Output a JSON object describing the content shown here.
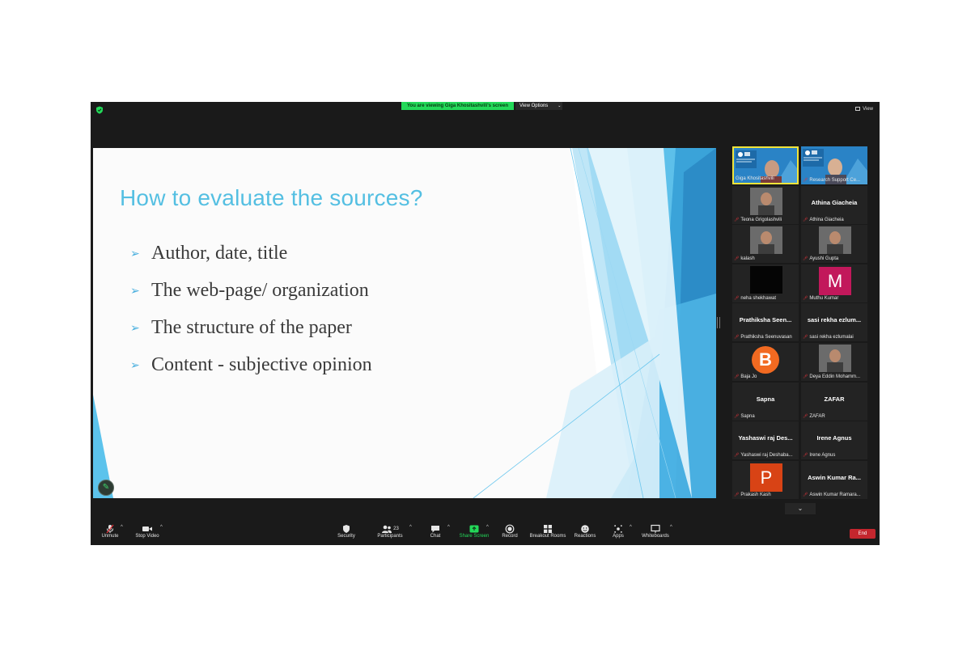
{
  "top_bar": {
    "viewing_banner": "You are viewing Giga Khositashvili's screen",
    "view_options_label": "View Options",
    "view_button_label": "View"
  },
  "slide": {
    "title": "How to evaluate the sources?",
    "bullets": [
      "Author, date, title",
      "The web-page/ organization",
      "The structure of the paper",
      "Content - subjective opinion"
    ],
    "bullet_marker": "➢",
    "accent_color": "#54bfe2"
  },
  "participants": [
    {
      "display": "",
      "label": "Giga Khositashvili",
      "type": "video-banner",
      "active": true
    },
    {
      "display": "",
      "label": "Research Support Ce...",
      "type": "video-banner"
    },
    {
      "display": "",
      "label": "Teona Grigolashvili",
      "type": "photo"
    },
    {
      "display": "Athina Giacheia",
      "label": "Athina Giacheia",
      "type": "name"
    },
    {
      "display": "",
      "label": "kalash",
      "type": "photo"
    },
    {
      "display": "",
      "label": "Ayushi Gupta",
      "type": "photo"
    },
    {
      "display": "",
      "label": "neha shekhawat",
      "type": "black"
    },
    {
      "display": "M",
      "label": "Muthu Kumar",
      "type": "letter",
      "color": "#c2185b"
    },
    {
      "display": "Prathiksha Seen...",
      "label": "Prathiksha Seenuvasan",
      "type": "name"
    },
    {
      "display": "sasi rekha ezlum...",
      "label": "sasi rekha ezlumalai",
      "type": "name"
    },
    {
      "display": "B",
      "label": "Baja Jo",
      "type": "letter-circle",
      "color": "#f26a21"
    },
    {
      "display": "",
      "label": "Deya Eddin Mohamm...",
      "type": "photo"
    },
    {
      "display": "Sapna",
      "label": "Sapna",
      "type": "name"
    },
    {
      "display": "ZAFAR",
      "label": "ZAFAR",
      "type": "name"
    },
    {
      "display": "Yashaswi raj Des...",
      "label": "Yashaswi raj Deshaba...",
      "type": "name"
    },
    {
      "display": "Irene Agnus",
      "label": "Irene Agnus",
      "type": "name"
    },
    {
      "display": "P",
      "label": "Prakash Kash",
      "type": "letter",
      "color": "#d84315"
    },
    {
      "display": "Aswin Kumar Ra...",
      "label": "Aswin Kumar Ramara...",
      "type": "name"
    }
  ],
  "toolbar": {
    "unmute": "Unmute",
    "stop_video": "Stop Video",
    "security": "Security",
    "participants": "Participants",
    "participants_count": "23",
    "chat": "Chat",
    "share_screen": "Share Screen",
    "record": "Record",
    "breakout_rooms": "Breakout Rooms",
    "reactions": "Reactions",
    "apps": "Apps",
    "whiteboards": "Whiteboards",
    "end": "End"
  },
  "colors": {
    "share_green": "#23d959",
    "end_red": "#c4262e",
    "active_speaker": "#f1e43a",
    "muted_red": "#e0333a"
  }
}
